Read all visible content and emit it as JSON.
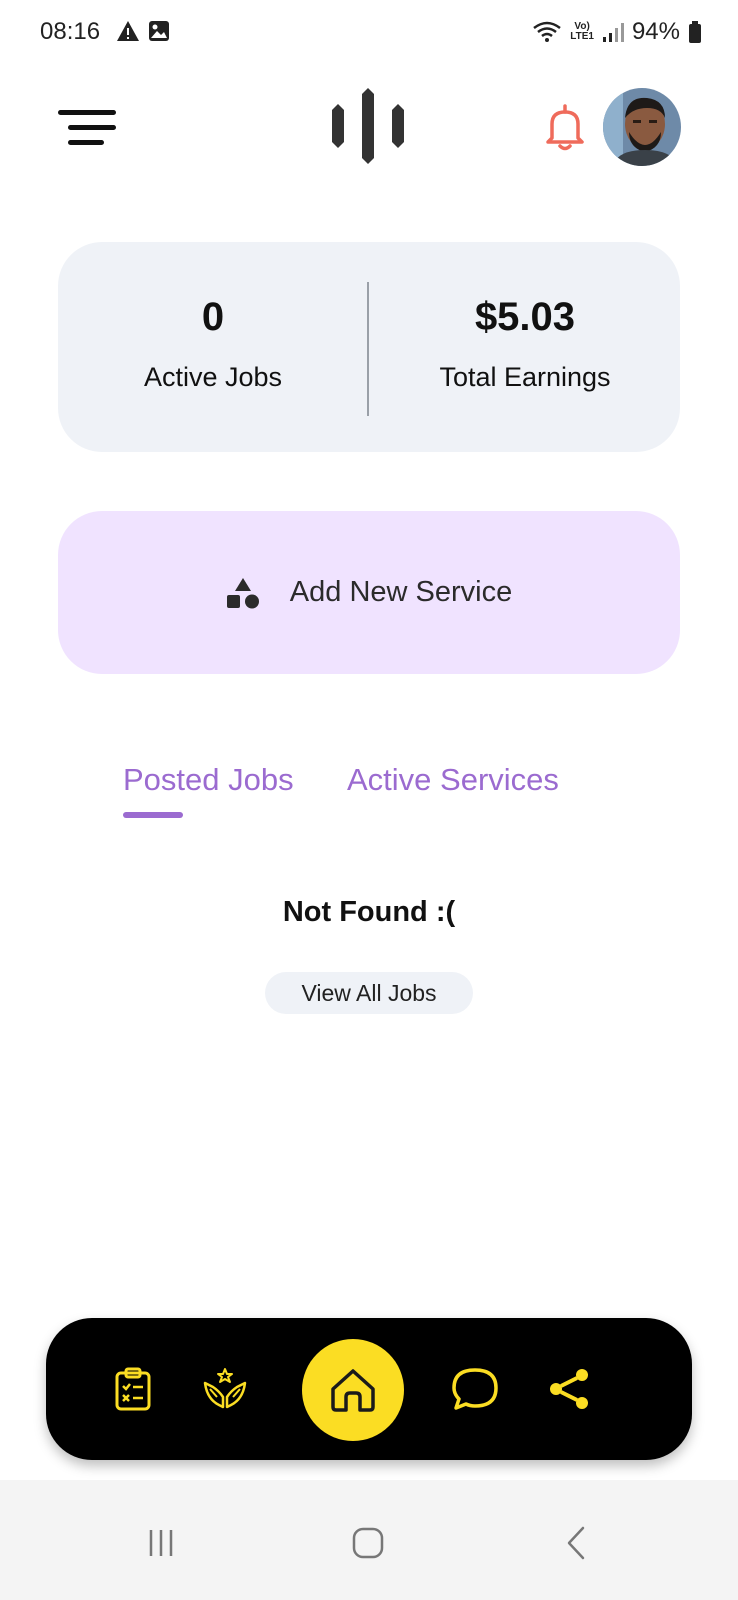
{
  "status_bar": {
    "time": "08:16",
    "battery": "94%",
    "network": "VoLTE1"
  },
  "header": {
    "menu_icon": "hamburger-menu-icon",
    "logo_icon": "app-logo-bars",
    "bell_icon": "bell-icon",
    "bell_color": "#ef6b5b"
  },
  "stats": {
    "active_jobs_value": "0",
    "active_jobs_label": "Active Jobs",
    "total_earnings_value": "$5.03",
    "total_earnings_label": "Total Earnings"
  },
  "add_service": {
    "label": "Add New Service",
    "icon": "shapes-icon"
  },
  "tabs": [
    {
      "label": "Posted Jobs",
      "selected": true
    },
    {
      "label": "Active Services",
      "selected": false
    }
  ],
  "empty_state": {
    "message": "Not Found :(",
    "button_label": "View All Jobs"
  },
  "bottom_nav": {
    "items": [
      "clipboard-list-icon",
      "hands-star-icon",
      "home-icon",
      "chat-bubble-icon",
      "share-icon"
    ],
    "accent": "#fbdd23"
  },
  "colors": {
    "tab_accent": "#9b6bd0",
    "card_bg": "#eff2f7",
    "service_bg": "#f0e3ff"
  }
}
